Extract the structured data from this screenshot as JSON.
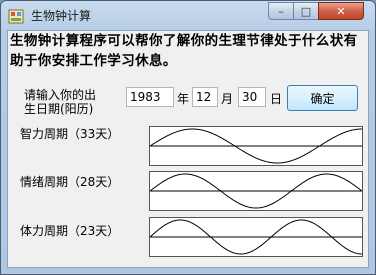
{
  "window": {
    "title": "生物钟计算",
    "controls": {
      "minimize": "–",
      "maximize": "□",
      "close": "✕"
    }
  },
  "intro_text": "生物钟计算程序可以帮你了解你的生理节律处于什么状有助于你安排工作学习休息。",
  "birth": {
    "label": "请输入你的出生日期(阳历)",
    "year": "1983",
    "year_unit": "年",
    "month": "12",
    "month_unit": "月",
    "day": "30",
    "day_unit": "日",
    "confirm_label": "确定"
  },
  "cycles": [
    {
      "label": "智力周期（33天）",
      "wave_cycles": 1.25,
      "phase": 0.0
    },
    {
      "label": "情绪周期（28天）",
      "wave_cycles": 1.5,
      "phase": 0.0
    },
    {
      "label": "体力周期（23天）",
      "wave_cycles": 1.75,
      "phase": 0.0
    }
  ],
  "icons": {
    "app": "app-icon"
  }
}
